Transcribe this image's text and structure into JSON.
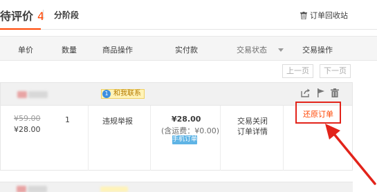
{
  "tabs": {
    "to_review_label": "待评价",
    "to_review_count": "4",
    "installment_label": "分阶段",
    "recycle_label": "订单回收站",
    "recycle_icon": "trash-icon"
  },
  "table_header": {
    "unit_price": "单价",
    "quantity": "数量",
    "product_actions": "商品操作",
    "paid": "实付款",
    "trade_status": "交易状态",
    "trade_actions": "交易操作"
  },
  "pager": {
    "prev": "上一页",
    "next": "下一页"
  },
  "order": {
    "contact_label": "和我联系",
    "contact_badge": "1",
    "head_icons": [
      "share-icon",
      "flag-icon",
      "trash-icon"
    ],
    "original_price": "¥59.00",
    "unit_price": "¥28.00",
    "quantity": "1",
    "product_action": "违规举报",
    "total": "¥28.00",
    "shipping": "(含运费：¥0.00)",
    "mobile_tag": "手机订单",
    "status": "交易关闭",
    "details": "订单详情",
    "restore": "还原订单"
  },
  "colors": {
    "accent": "#ff4400",
    "highlight_red": "#e2231a",
    "mobile_tag": "#5fb4e5"
  }
}
